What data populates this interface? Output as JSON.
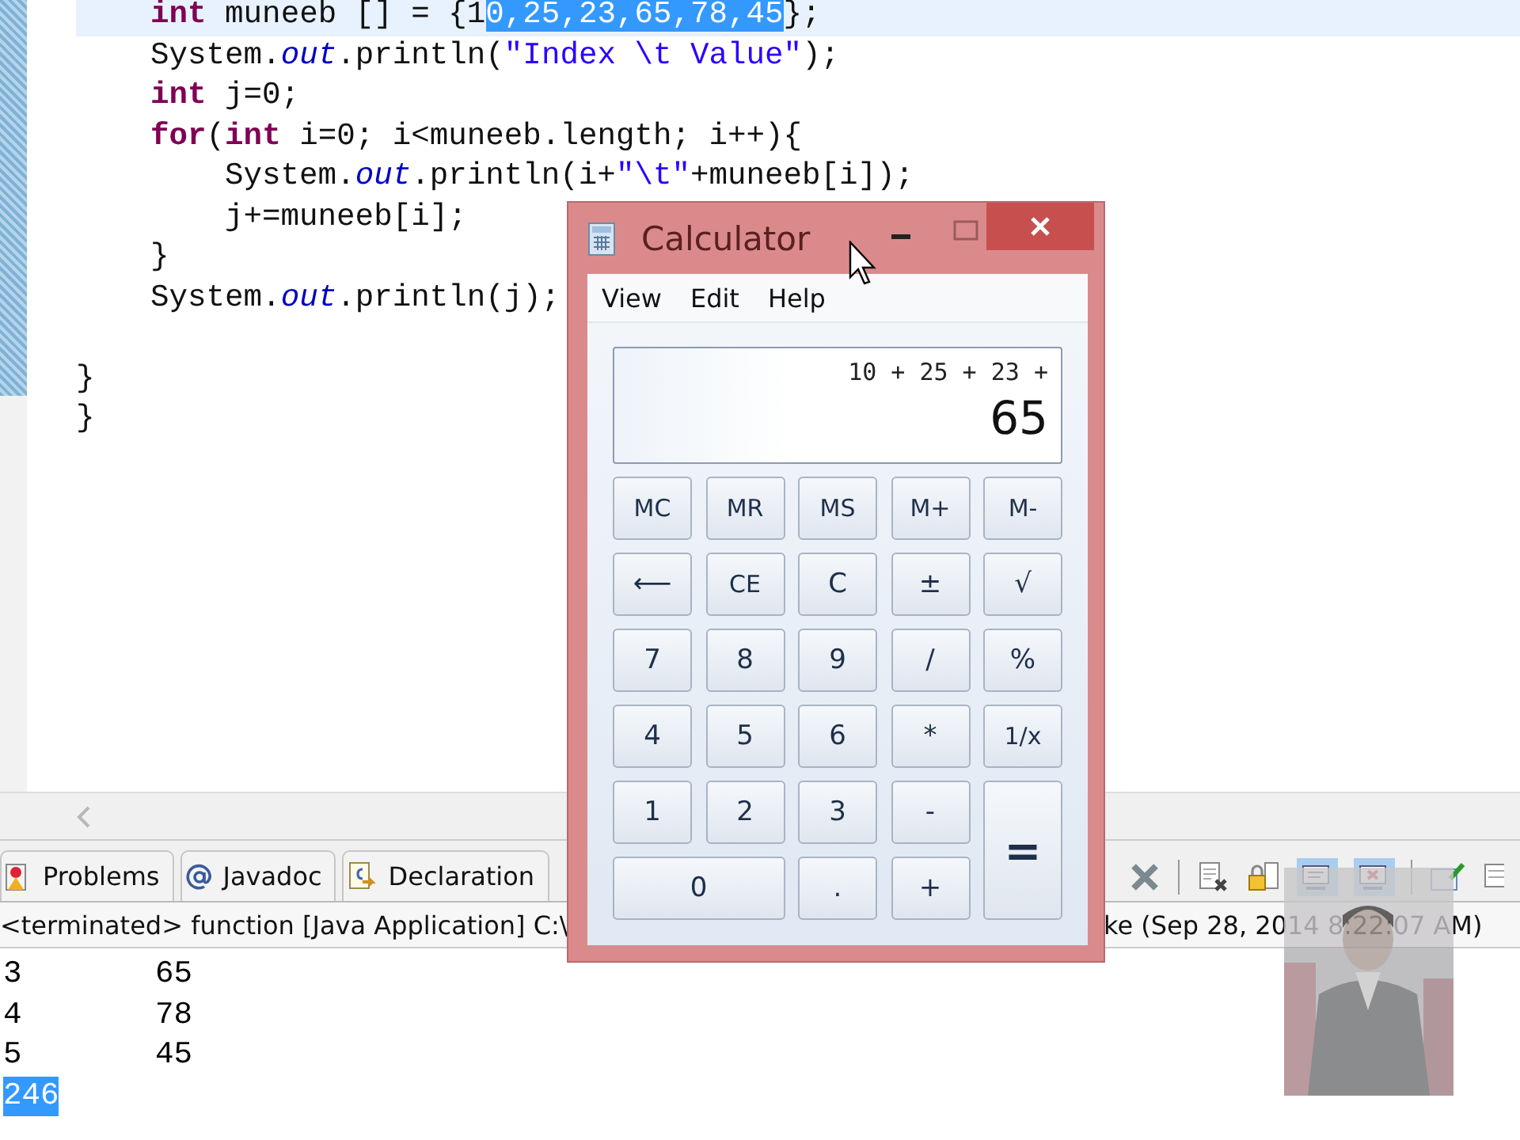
{
  "editor": {
    "lines": [
      {
        "kind": "block",
        "children": [
          {
            "kind": "code",
            "current": true,
            "tokens": [
              {
                "kind": "keyword",
                "text": "int"
              },
              {
                "kind": "plain",
                "text": " muneeb [] = {1"
              },
              {
                "kind": "selected",
                "text": "0,25,23,65,78,45"
              },
              {
                "kind": "plain",
                "text": "};"
              }
            ]
          },
          {
            "kind": "code",
            "current": false,
            "tokens": [
              {
                "kind": "plain",
                "text": "System."
              },
              {
                "kind": "field",
                "text": "out"
              },
              {
                "kind": "plain",
                "text": ".println("
              },
              {
                "kind": "string",
                "text": "\"Index \\t Value\""
              },
              {
                "kind": "plain",
                "text": ");"
              }
            ]
          },
          {
            "kind": "code",
            "current": false,
            "tokens": [
              {
                "kind": "keyword",
                "text": "int"
              },
              {
                "kind": "plain",
                "text": " j=0;"
              }
            ]
          },
          {
            "kind": "code",
            "current": false,
            "tokens": [
              {
                "kind": "keyword",
                "text": "for"
              },
              {
                "kind": "plain",
                "text": "("
              },
              {
                "kind": "keyword",
                "text": "int"
              },
              {
                "kind": "plain",
                "text": " i=0; i<muneeb.length; i++){"
              }
            ],
            "children": [
              {
                "kind": "code",
                "current": false,
                "tokens": [
                  {
                    "kind": "plain",
                    "text": "System."
                  },
                  {
                    "kind": "field",
                    "text": "out"
                  },
                  {
                    "kind": "plain",
                    "text": ".println(i+"
                  },
                  {
                    "kind": "string",
                    "text": "\"\\t\""
                  },
                  {
                    "kind": "plain",
                    "text": "+muneeb[i]);"
                  }
                ]
              },
              {
                "kind": "code",
                "current": false,
                "tokens": [
                  {
                    "kind": "plain",
                    "text": "j+=muneeb[i];"
                  }
                ]
              }
            ]
          },
          {
            "kind": "code",
            "current": false,
            "tokens": [
              {
                "kind": "plain",
                "text": "}"
              }
            ]
          },
          {
            "kind": "code",
            "current": false,
            "tokens": [
              {
                "kind": "plain",
                "text": "System."
              },
              {
                "kind": "field",
                "text": "out"
              },
              {
                "kind": "plain",
                "text": ".println(j);"
              }
            ]
          }
        ]
      },
      {
        "kind": "blank"
      },
      {
        "kind": "code",
        "current": false,
        "tokens": [
          {
            "kind": "plain",
            "text": "}"
          }
        ]
      },
      {
        "kind": "code",
        "current": false,
        "tokens": [
          {
            "kind": "plain",
            "text": "}"
          }
        ]
      }
    ]
  },
  "panel": {
    "tabs": [
      {
        "label": "Problems"
      },
      {
        "label": "Javadoc"
      },
      {
        "label": "Declaration"
      }
    ],
    "console_header": {
      "left": "<terminated> function [Java Application] C:\\",
      "right": "ke (Sep 28, 2014 8:22:07 AM)"
    },
    "console_lines": [
      {
        "columns": [
          "3",
          "65"
        ],
        "selected": false
      },
      {
        "columns": [
          "4",
          "78"
        ],
        "selected": false
      },
      {
        "columns": [
          "5",
          "45"
        ],
        "selected": false
      },
      {
        "columns": [
          "246"
        ],
        "selected": true
      }
    ]
  },
  "calculator": {
    "title": "Calculator",
    "menu": [
      "View",
      "Edit",
      "Help"
    ],
    "display": {
      "expression": "10 + 25 + 23 +",
      "value": "65"
    },
    "keys": [
      {
        "label": "MC",
        "kind": "key"
      },
      {
        "label": "MR",
        "kind": "key"
      },
      {
        "label": "MS",
        "kind": "key"
      },
      {
        "label": "M+",
        "kind": "key"
      },
      {
        "label": "M-",
        "kind": "key"
      },
      {
        "label": "⟵",
        "kind": "key"
      },
      {
        "label": "CE",
        "kind": "key"
      },
      {
        "label": "C",
        "kind": "key"
      },
      {
        "label": "±",
        "kind": "key"
      },
      {
        "label": "√",
        "kind": "key"
      },
      {
        "label": "7",
        "kind": "key"
      },
      {
        "label": "8",
        "kind": "key"
      },
      {
        "label": "9",
        "kind": "key"
      },
      {
        "label": "/",
        "kind": "key"
      },
      {
        "label": "%",
        "kind": "key"
      },
      {
        "label": "4",
        "kind": "key"
      },
      {
        "label": "5",
        "kind": "key"
      },
      {
        "label": "6",
        "kind": "key"
      },
      {
        "label": "*",
        "kind": "key"
      },
      {
        "label": "1/x",
        "kind": "key"
      },
      {
        "label": "1",
        "kind": "key"
      },
      {
        "label": "2",
        "kind": "key"
      },
      {
        "label": "3",
        "kind": "key"
      },
      {
        "label": "-",
        "kind": "key"
      },
      {
        "label": "=",
        "kind": "tall"
      },
      {
        "label": "0",
        "kind": "wide"
      },
      {
        "label": ".",
        "kind": "key"
      },
      {
        "label": "+",
        "kind": "key"
      }
    ]
  }
}
